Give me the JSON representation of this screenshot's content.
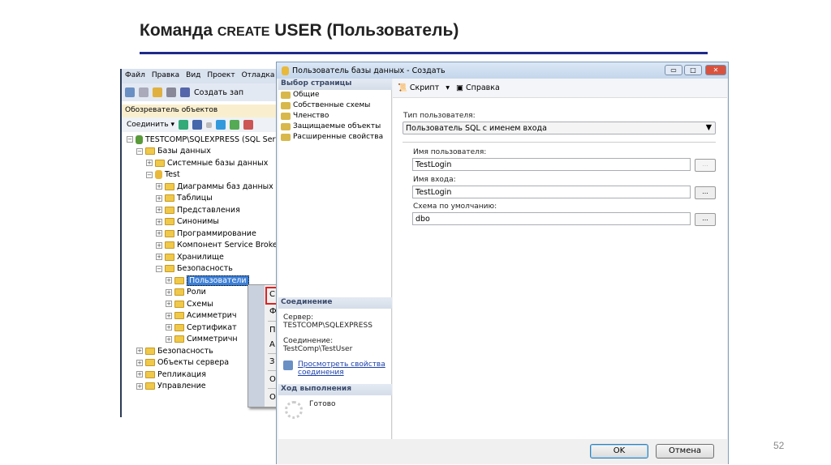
{
  "slide": {
    "title_main": "Команда ",
    "title_sc": "CREATE",
    "title_rest": " USER (Пользователь)",
    "page_number": "52"
  },
  "ssms": {
    "menu": [
      "Файл",
      "Правка",
      "Вид",
      "Проект",
      "Отладка"
    ],
    "toolbar_new_query": "Создать зап",
    "object_explorer": "Обозреватель объектов",
    "connect": "Соединить ▾",
    "tree": [
      "TESTCOMP\\SQLEXPRESS (SQL Serve",
      "Базы данных",
      "Системные базы данных",
      "Test",
      "Диаграммы баз данных",
      "Таблицы",
      "Представления",
      "Синонимы",
      "Программирование",
      "Компонент Service Broke",
      "Хранилище",
      "Безопасность",
      "Пользователи",
      "Роли",
      "Схемы",
      "Асимметрич",
      "Сертификат",
      "Симметричн",
      "Безопасность",
      "Объекты сервера",
      "Репликация",
      "Управление"
    ],
    "context_menu": [
      "С",
      "Ф",
      "П",
      "А",
      "З",
      "О",
      "О"
    ]
  },
  "dialog": {
    "title": "Пользователь базы данных - Создать",
    "select_page": "Выбор страницы",
    "pages": [
      "Общие",
      "Собственные схемы",
      "Членство",
      "Защищаемые объекты",
      "Расширенные свойства"
    ],
    "connection_header": "Соединение",
    "server_label": "Сервер:",
    "server": "TESTCOMP\\SQLEXPRESS",
    "connection_label": "Соединение:",
    "connection": "TestComp\\TestUser",
    "view_props": "Просмотреть свойства соединения",
    "progress_header": "Ход выполнения",
    "progress_status": "Готово",
    "script": "Скрипт",
    "help": "Справка",
    "user_type_label": "Тип пользователя:",
    "user_type": "Пользователь SQL с именем входа",
    "user_name_label": "Имя пользователя:",
    "user_name": "TestLogin",
    "login_label": "Имя входа:",
    "login": "TestLogin",
    "schema_label": "Схема по умолчанию:",
    "schema": "dbo",
    "browse": "...",
    "ok": "OK",
    "cancel": "Отмена"
  }
}
